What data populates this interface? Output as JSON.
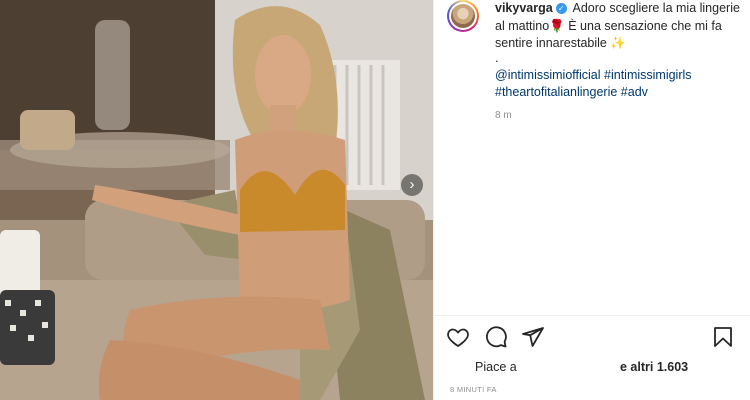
{
  "post": {
    "username": "vikyvarga",
    "verified_badge": "✓",
    "caption_text": "Adoro scegliere la mia lingerie al mattino🌹 È una sensazione che mi fa sentire innarestabile ✨",
    "dot": ".",
    "tags": [
      "@intimissimiofficial",
      "#intimissimigirls",
      "#theartofitalianlingerie",
      "#adv"
    ],
    "caption_age": "8 m",
    "next_arrow": "›"
  },
  "actions": {
    "icons": [
      "heart-icon",
      "comment-icon",
      "share-icon",
      "bookmark-icon"
    ]
  },
  "likes": {
    "prefix": "Piace a",
    "suffix": "e altri 1.603"
  },
  "timestamp": "8 MINUTI FA",
  "colors": {
    "verified": "#3897f0",
    "tag": "#00376b",
    "muted": "#8e8e8e",
    "text": "#262626"
  }
}
